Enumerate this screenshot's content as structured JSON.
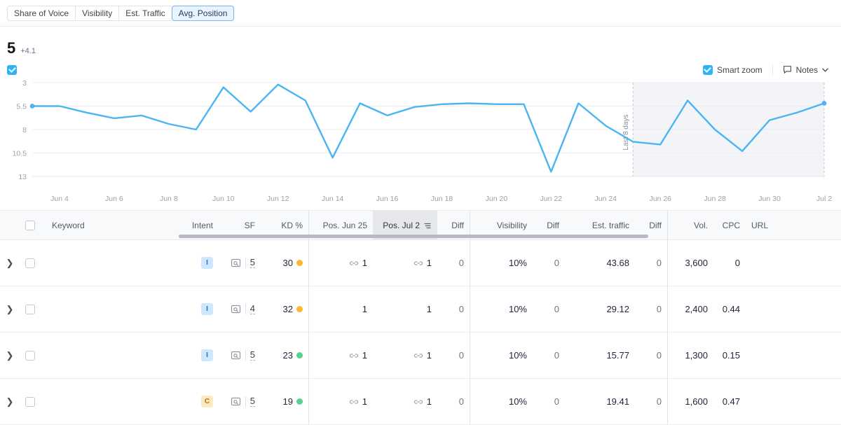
{
  "colors": {
    "line": "#4db4f2",
    "accent": "#2bb3fb",
    "kd_orange": "#ffb733",
    "kd_green": "#56d28a",
    "shade": "#f2f4f7"
  },
  "tabs": [
    {
      "label": "Share of Voice",
      "active": false
    },
    {
      "label": "Visibility",
      "active": false
    },
    {
      "label": "Est. Traffic",
      "active": false
    },
    {
      "label": "Avg. Position",
      "active": true
    }
  ],
  "metric": {
    "value": "5",
    "delta": "+4.1"
  },
  "chart_controls": {
    "series_checkbox_checked": true,
    "smart_zoom_label": "Smart zoom",
    "smart_zoom_checked": true,
    "notes_label": "Notes",
    "notes_icon": "speech-bubble-icon",
    "chevron_icon": "chevron-down-icon"
  },
  "chart_data": {
    "type": "line",
    "title": "Avg. Position",
    "xlabel": "",
    "ylabel": "Avg. Position",
    "ylim": [
      3,
      13
    ],
    "y_inverted": true,
    "yticks": [
      "3",
      "5.5",
      "8",
      "10.5",
      "13"
    ],
    "grid": true,
    "legend": "none",
    "annotation": "Last 8 days",
    "highlight_region": {
      "start": "Jun 25",
      "end": "Jul 2"
    },
    "xticks": [
      "Jun 4",
      "Jun 6",
      "Jun 8",
      "Jun 10",
      "Jun 12",
      "Jun 14",
      "Jun 16",
      "Jun 18",
      "Jun 20",
      "Jun 22",
      "Jun 24",
      "Jun 26",
      "Jun 28",
      "Jun 30",
      "Jul 2"
    ],
    "x": [
      "Jun 3",
      "Jun 4",
      "Jun 5",
      "Jun 6",
      "Jun 7",
      "Jun 8",
      "Jun 9",
      "Jun 10",
      "Jun 11",
      "Jun 12",
      "Jun 13",
      "Jun 14",
      "Jun 15",
      "Jun 16",
      "Jun 17",
      "Jun 18",
      "Jun 19",
      "Jun 20",
      "Jun 21",
      "Jun 22",
      "Jun 23",
      "Jun 24",
      "Jun 25",
      "Jun 26",
      "Jun 27",
      "Jun 28",
      "Jun 29",
      "Jun 30",
      "Jul 1",
      "Jul 2"
    ],
    "values": [
      5.5,
      5.5,
      6.2,
      6.8,
      6.5,
      7.4,
      8.0,
      3.5,
      6.1,
      3.2,
      4.9,
      11.0,
      5.2,
      6.5,
      5.6,
      5.3,
      5.2,
      5.3,
      5.3,
      12.5,
      5.2,
      7.6,
      9.3,
      9.6,
      4.9,
      8.0,
      10.3,
      7.0,
      6.2,
      5.2
    ]
  },
  "table": {
    "columns": [
      {
        "key": "expand",
        "label": "",
        "align": "left"
      },
      {
        "key": "select",
        "label": "",
        "align": "left"
      },
      {
        "key": "keyword",
        "label": "Keyword",
        "align": "left"
      },
      {
        "key": "intent",
        "label": "Intent",
        "align": "right"
      },
      {
        "key": "sf",
        "label": "SF",
        "align": "right"
      },
      {
        "key": "kd",
        "label": "KD %",
        "align": "right"
      },
      {
        "key": "pos_prev",
        "label": "Pos. Jun 25",
        "align": "right"
      },
      {
        "key": "pos_cur",
        "label": "Pos. Jul 2",
        "align": "right",
        "sorted": true
      },
      {
        "key": "pos_diff",
        "label": "Diff",
        "align": "right"
      },
      {
        "key": "visibility",
        "label": "Visibility",
        "align": "right"
      },
      {
        "key": "vis_diff",
        "label": "Diff",
        "align": "right"
      },
      {
        "key": "traffic",
        "label": "Est. traffic",
        "align": "right"
      },
      {
        "key": "traf_diff",
        "label": "Diff",
        "align": "right"
      },
      {
        "key": "vol",
        "label": "Vol.",
        "align": "right"
      },
      {
        "key": "cpc",
        "label": "CPC",
        "align": "right"
      },
      {
        "key": "url",
        "label": "URL",
        "align": "left"
      }
    ],
    "header_select_all_checked": false,
    "sort_icon": "sort-icon",
    "rows": [
      {
        "keyword": "",
        "intent": "I",
        "intent_type": "informational",
        "sf_icon": "serp-feature-icon",
        "sf": "5",
        "kd": "30",
        "kd_color": "orange",
        "pos_prev": "1",
        "pos_prev_icon": "link-icon",
        "pos_cur": "1",
        "pos_cur_icon": "link-icon",
        "pos_diff": "0",
        "visibility": "10%",
        "vis_diff": "0",
        "traffic": "43.68",
        "traf_diff": "0",
        "vol": "3,600",
        "cpc": "0",
        "url": ""
      },
      {
        "keyword": "",
        "intent": "I",
        "intent_type": "informational",
        "sf_icon": "serp-feature-icon",
        "sf": "4",
        "kd": "32",
        "kd_color": "orange",
        "pos_prev": "1",
        "pos_prev_icon": "",
        "pos_cur": "1",
        "pos_cur_icon": "",
        "pos_diff": "0",
        "visibility": "10%",
        "vis_diff": "0",
        "traffic": "29.12",
        "traf_diff": "0",
        "vol": "2,400",
        "cpc": "0.44",
        "url": ""
      },
      {
        "keyword": "",
        "intent": "I",
        "intent_type": "informational",
        "sf_icon": "serp-feature-icon",
        "sf": "5",
        "kd": "23",
        "kd_color": "green",
        "pos_prev": "1",
        "pos_prev_icon": "link-icon",
        "pos_cur": "1",
        "pos_cur_icon": "link-icon",
        "pos_diff": "0",
        "visibility": "10%",
        "vis_diff": "0",
        "traffic": "15.77",
        "traf_diff": "0",
        "vol": "1,300",
        "cpc": "0.15",
        "url": ""
      },
      {
        "keyword": "",
        "intent": "C",
        "intent_type": "commercial",
        "sf_icon": "serp-feature-icon",
        "sf": "5",
        "kd": "19",
        "kd_color": "green",
        "pos_prev": "1",
        "pos_prev_icon": "link-icon",
        "pos_cur": "1",
        "pos_cur_icon": "link-icon",
        "pos_diff": "0",
        "visibility": "10%",
        "vis_diff": "0",
        "traffic": "19.41",
        "traf_diff": "0",
        "vol": "1,600",
        "cpc": "0.47",
        "url": ""
      }
    ]
  }
}
